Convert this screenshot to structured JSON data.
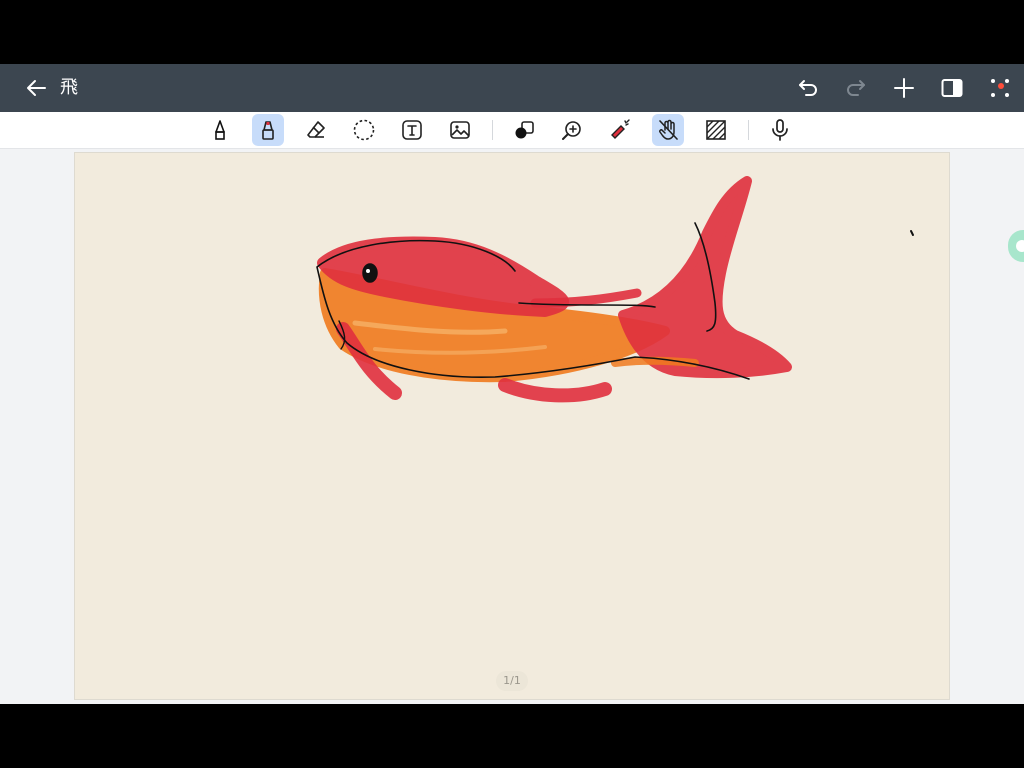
{
  "titlebar": {
    "title": "飛",
    "back_icon": "arrow-left-icon",
    "actions": [
      "undo-icon",
      "redo-icon",
      "plus-icon",
      "split-view-icon",
      "more-icon"
    ],
    "notification_color": "#ff4d3a"
  },
  "toolbar": {
    "tools": [
      {
        "name": "pen-tool",
        "icon": "pen-icon",
        "active": false
      },
      {
        "name": "highlighter-tool",
        "icon": "highlighter-icon",
        "active": true
      },
      {
        "name": "eraser-tool",
        "icon": "eraser-icon",
        "active": false
      },
      {
        "name": "lasso-tool",
        "icon": "lasso-icon",
        "active": false
      },
      {
        "name": "text-tool",
        "icon": "text-box-icon",
        "active": false
      },
      {
        "name": "image-tool",
        "icon": "image-icon",
        "active": false
      },
      {
        "name": "shapes-tool",
        "icon": "shapes-icon",
        "active": false
      },
      {
        "name": "zoom-tool",
        "icon": "zoom-in-icon",
        "active": false
      },
      {
        "name": "laser-tool",
        "icon": "laser-pointer-icon",
        "active": false
      },
      {
        "name": "touch-draw-toggle",
        "icon": "hand-off-icon",
        "active": true
      },
      {
        "name": "pattern-tool",
        "icon": "hatch-pattern-icon",
        "active": false
      },
      {
        "name": "voice-tool",
        "icon": "microphone-icon",
        "active": false
      }
    ],
    "active_color": "#c7dcfa"
  },
  "canvas": {
    "background": "#f2ebdd",
    "drawing": "goldfish-sketch",
    "colors": {
      "red": "#e0303e",
      "orange": "#f07a1e",
      "outline": "#111111"
    }
  },
  "page_indicator": "1/1",
  "colors": {
    "titlebar_bg": "#3c4650",
    "app_bg": "#f2f3f5",
    "side_bubble": "#a8e6cc"
  }
}
